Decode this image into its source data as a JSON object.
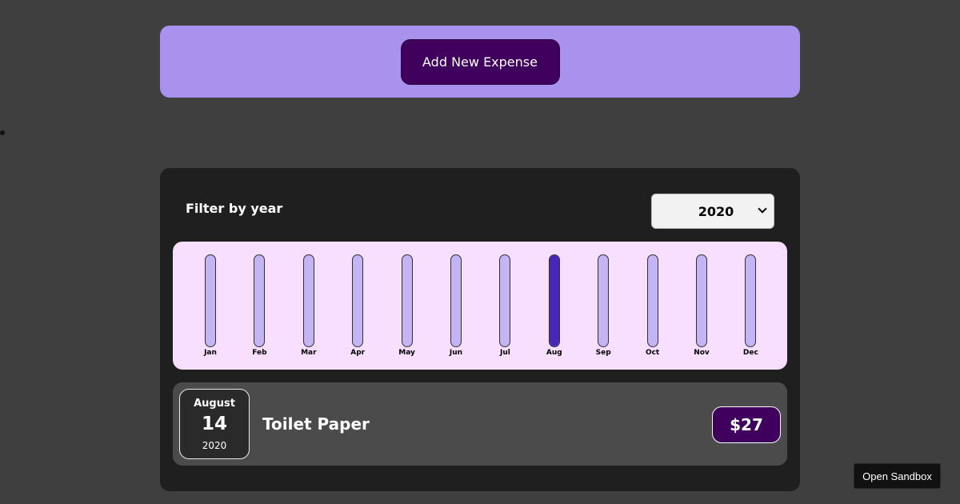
{
  "new_expense": {
    "add_button_label": "Add New Expense",
    "background": "#a892ee",
    "button_color": "#40005d"
  },
  "filter": {
    "label": "Filter by year",
    "selected_year": "2020"
  },
  "chart_data": {
    "type": "bar",
    "categories": [
      "Jan",
      "Feb",
      "Mar",
      "Apr",
      "May",
      "Jun",
      "Jul",
      "Aug",
      "Sep",
      "Oct",
      "Nov",
      "Dec"
    ],
    "values": [
      0,
      0,
      0,
      0,
      0,
      0,
      0,
      27,
      0,
      0,
      0,
      0
    ],
    "ylim": [
      0,
      27
    ],
    "fill_color": "#4826b9",
    "track_color": "#c3b4f3"
  },
  "expenses": [
    {
      "month": "August",
      "day": "14",
      "year": "2020",
      "title": "Toilet Paper",
      "amount": "$27"
    }
  ],
  "sandbox": {
    "label": "Open Sandbox"
  }
}
